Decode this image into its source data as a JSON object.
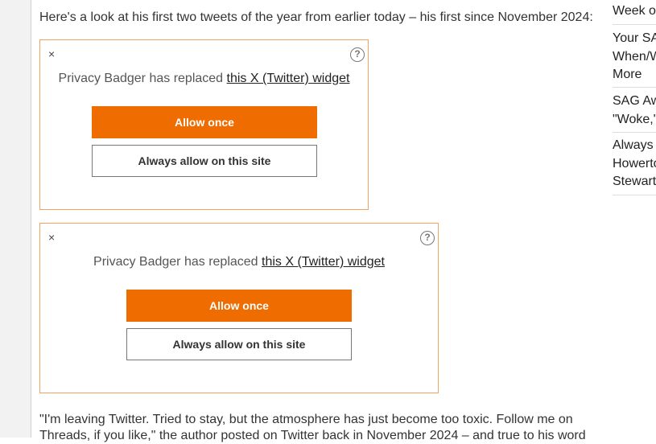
{
  "article": {
    "intro": "Here's a look at his first two tweets of the year from earlier today – his first since November 2024:",
    "quote": "\"I'm leaving Twitter. Tried to stay, but the atmosphere has just become too toxic. Follow me on Threads, if you like,\" the author posted on Twitter back in November 2024 – and true to his word"
  },
  "widgets": [
    {
      "close": "×",
      "help": "?",
      "message_prefix": "Privacy Badger has replaced",
      "message_link": "this X (Twitter) widget",
      "allow_once": "Allow once",
      "always_allow": "Always allow on this site"
    },
    {
      "close": "×",
      "help": "?",
      "message_prefix": "Privacy Badger has replaced",
      "message_link": "this X (Twitter) widget",
      "allow_once": "Allow once",
      "always_allow": "Always allow on this site"
    }
  ],
  "sidebar": {
    "items": [
      {
        "lines": [
          "Week o"
        ]
      },
      {
        "lines": [
          "Your SA",
          "When/W",
          "More"
        ]
      },
      {
        "lines": [
          "SAG Aw",
          "\"Woke,\""
        ]
      },
      {
        "lines": [
          "Always",
          "Howerto",
          "Stewart"
        ]
      }
    ]
  },
  "colors": {
    "accent": "#ef6c00",
    "widget_border": "#f2a363",
    "text": "#333333"
  }
}
